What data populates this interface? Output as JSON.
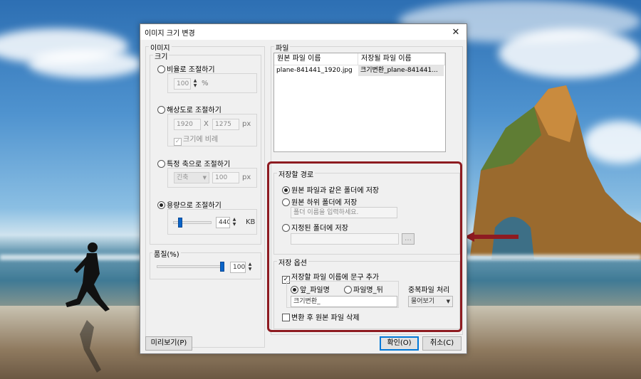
{
  "dialog": {
    "title": "이미지 크기 변경",
    "close_glyph": "✕"
  },
  "image_group": {
    "label": "이미지",
    "size": {
      "label": "크기",
      "ratio": {
        "label": "비율로 조절하기",
        "value": "100",
        "unit": "%"
      },
      "resolution": {
        "label": "해상도로 조절하기",
        "width": "1920",
        "x": "X",
        "height": "1275",
        "unit": "px",
        "keep_ratio": "크기에 비례",
        "keep_ratio_glyph": "✓"
      },
      "axis": {
        "label": "특정 축으로 조절하기",
        "axis_value": "긴축",
        "value": "100",
        "unit": "px"
      },
      "capacity": {
        "label": "용량으로 조절하기",
        "value": "440",
        "unit": "KB",
        "slider_fraction": 0.15
      }
    },
    "quality": {
      "label": "품질(%)",
      "value": "100",
      "slider_fraction": 1.0
    }
  },
  "file_group": {
    "label": "파일",
    "columns": [
      "원본 파일 이름",
      "저장될 파일 이름"
    ],
    "rows": [
      [
        "plane-841441_1920.jpg",
        "크기변환_plane-841441..."
      ]
    ]
  },
  "save_path": {
    "label": "저장할 경로",
    "same_folder": "원본 파일과 같은 폴더에 저장",
    "sub_folder": "원본 하위 폴더에 저장",
    "sub_folder_placeholder": "폴더 이름을 입력하세요.",
    "specified_folder": "지정된 폴더에 저장",
    "specified_folder_value": "",
    "browse_glyph": "…"
  },
  "save_options": {
    "label": "저장 옵션",
    "add_text": "저장할 파일 이름에 문구 추가",
    "check_glyph": "✓",
    "prefix": "앞_파일명",
    "suffix": "파일명_뒤",
    "text_value": "크기변환_",
    "duplicate_label": "중복파일 처리",
    "duplicate_value": "물어보기",
    "delete_original": "변환 후 원본 파일 삭제"
  },
  "buttons": {
    "preview": "미리보기(P)",
    "ok": "확인(O)",
    "cancel": "취소(C)"
  },
  "icons": {
    "spin_up": "▲",
    "spin_down": "▼",
    "dropdown": "▼"
  },
  "colors": {
    "highlight_border": "#8e1b21",
    "default_button": "#0078d7",
    "slider_thumb": "#0a64c8"
  }
}
